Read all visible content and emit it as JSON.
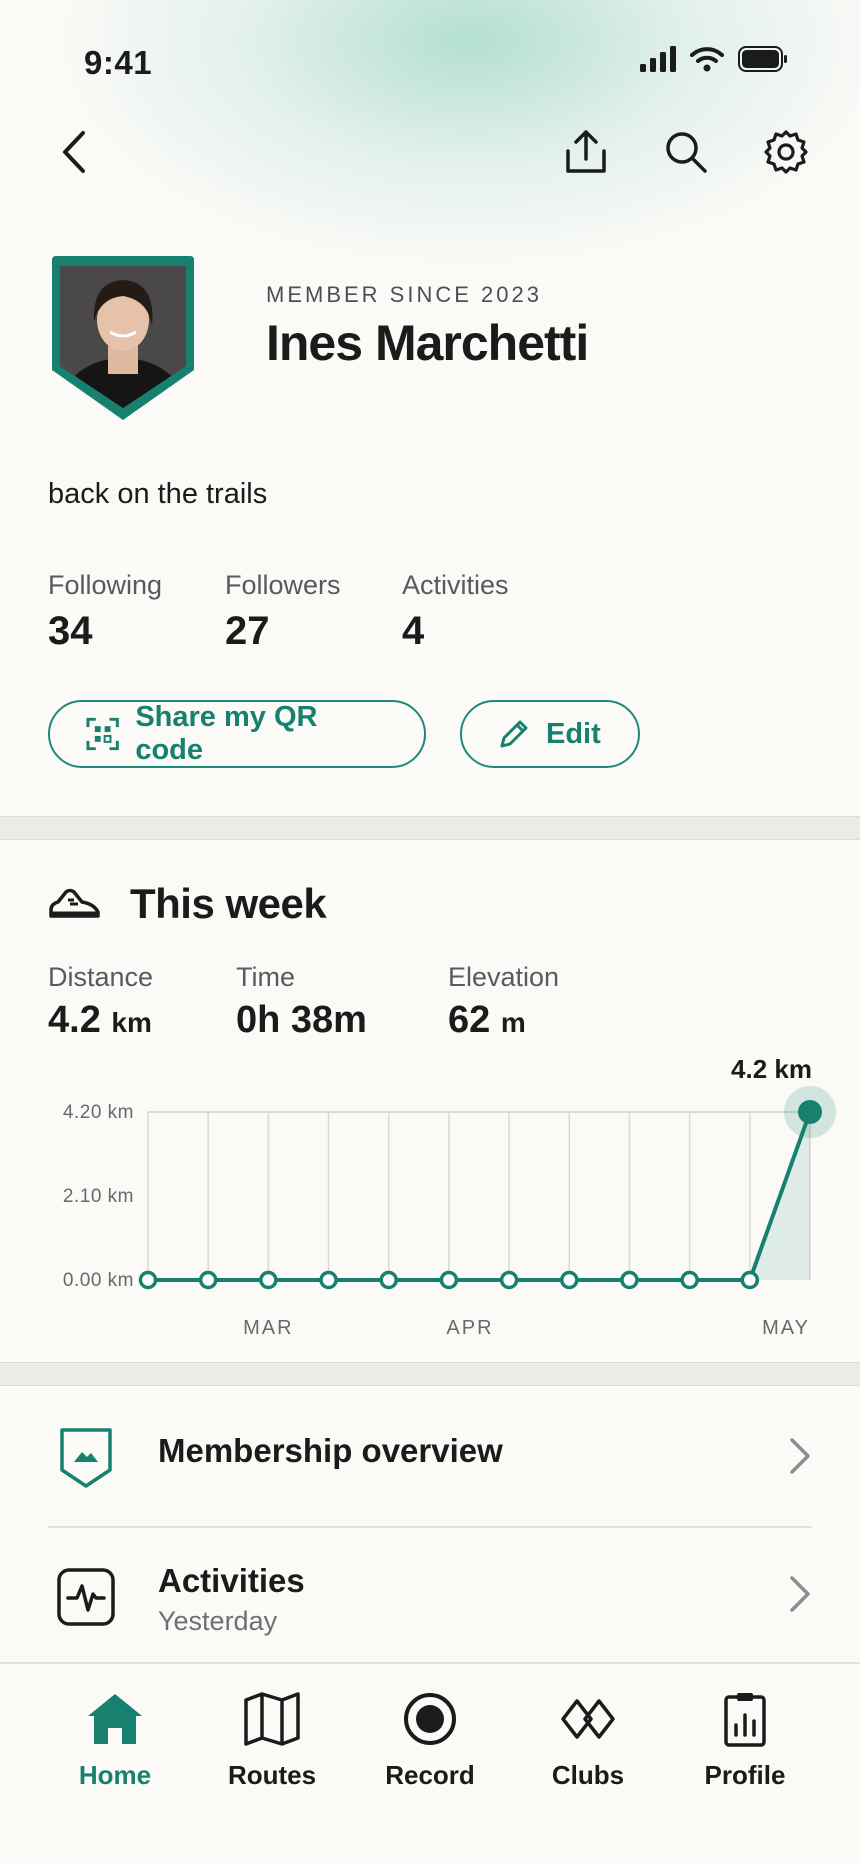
{
  "status_bar": {
    "time": "9:41"
  },
  "profile": {
    "member_since": "MEMBER SINCE 2023",
    "name": "Ines Marchetti",
    "bio": "back on the trails"
  },
  "stats": [
    {
      "label": "Following",
      "value": "34"
    },
    {
      "label": "Followers",
      "value": "27"
    },
    {
      "label": "Activities",
      "value": "4"
    }
  ],
  "actions": {
    "qr_label": "Share my QR code",
    "edit_label": "Edit"
  },
  "week": {
    "title": "This week",
    "distance_label": "Distance",
    "distance_value": "4.2",
    "distance_unit": "km",
    "time_label": "Time",
    "time_value": "0h 38m",
    "elevation_label": "Elevation",
    "elevation_value": "62",
    "elevation_unit": "m"
  },
  "chart_data": {
    "type": "line",
    "y_ticks": [
      "4.20 km",
      "2.10 km",
      "0.00 km"
    ],
    "ylim": [
      0,
      4.2
    ],
    "x_labels": [
      "MAR",
      "APR",
      "MAY"
    ],
    "values": [
      0,
      0,
      0,
      0,
      0,
      0,
      0,
      0,
      0,
      0,
      0,
      4.2
    ],
    "highlight_label": "4.2 km",
    "accent": "#17806f"
  },
  "list": [
    {
      "title": "Membership overview",
      "subtitle": ""
    },
    {
      "title": "Activities",
      "subtitle": "Yesterday"
    }
  ],
  "tabs": [
    {
      "label": "Home",
      "icon": "home-icon",
      "active": true
    },
    {
      "label": "Routes",
      "icon": "map-icon"
    },
    {
      "label": "Record",
      "icon": "record-icon"
    },
    {
      "label": "Clubs",
      "icon": "clubs-icon"
    },
    {
      "label": "Profile",
      "icon": "clipboard-chart-icon"
    }
  ],
  "colors": {
    "accent": "#17806f",
    "background": "#fbfaf7"
  }
}
